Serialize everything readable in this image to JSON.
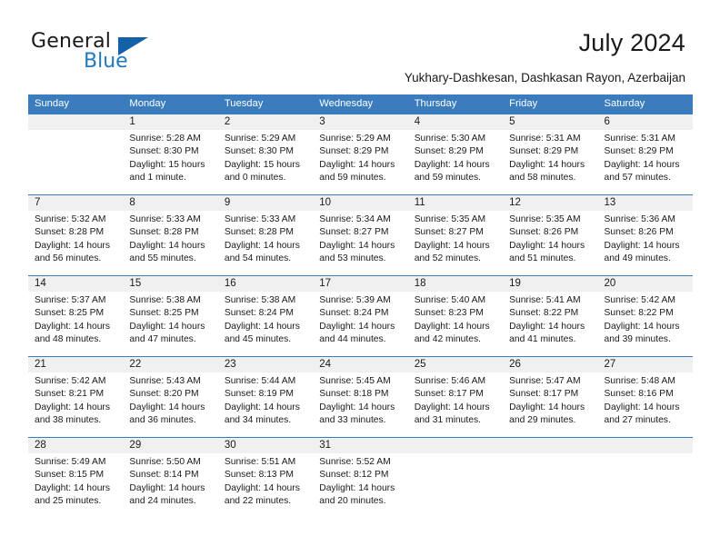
{
  "brand": {
    "word1": "General",
    "word2": "Blue",
    "triangle_icon": "triangle-icon",
    "blue": "#1f7ac0",
    "dark_blue": "#1361a6"
  },
  "header": {
    "month_year": "July 2024",
    "location": "Yukhary-Dashkesan, Dashkasan Rayon, Azerbaijan"
  },
  "calendar": {
    "header_bg": "#3a7cbe",
    "day_band_bg": "#f0f0f0",
    "weekdays": [
      "Sunday",
      "Monday",
      "Tuesday",
      "Wednesday",
      "Thursday",
      "Friday",
      "Saturday"
    ],
    "weeks": [
      [
        {
          "day": "",
          "l1": "",
          "l2": "",
          "l3": "",
          "l4": ""
        },
        {
          "day": "1",
          "l1": "Sunrise: 5:28 AM",
          "l2": "Sunset: 8:30 PM",
          "l3": "Daylight: 15 hours",
          "l4": "and 1 minute."
        },
        {
          "day": "2",
          "l1": "Sunrise: 5:29 AM",
          "l2": "Sunset: 8:30 PM",
          "l3": "Daylight: 15 hours",
          "l4": "and 0 minutes."
        },
        {
          "day": "3",
          "l1": "Sunrise: 5:29 AM",
          "l2": "Sunset: 8:29 PM",
          "l3": "Daylight: 14 hours",
          "l4": "and 59 minutes."
        },
        {
          "day": "4",
          "l1": "Sunrise: 5:30 AM",
          "l2": "Sunset: 8:29 PM",
          "l3": "Daylight: 14 hours",
          "l4": "and 59 minutes."
        },
        {
          "day": "5",
          "l1": "Sunrise: 5:31 AM",
          "l2": "Sunset: 8:29 PM",
          "l3": "Daylight: 14 hours",
          "l4": "and 58 minutes."
        },
        {
          "day": "6",
          "l1": "Sunrise: 5:31 AM",
          "l2": "Sunset: 8:29 PM",
          "l3": "Daylight: 14 hours",
          "l4": "and 57 minutes."
        }
      ],
      [
        {
          "day": "7",
          "l1": "Sunrise: 5:32 AM",
          "l2": "Sunset: 8:28 PM",
          "l3": "Daylight: 14 hours",
          "l4": "and 56 minutes."
        },
        {
          "day": "8",
          "l1": "Sunrise: 5:33 AM",
          "l2": "Sunset: 8:28 PM",
          "l3": "Daylight: 14 hours",
          "l4": "and 55 minutes."
        },
        {
          "day": "9",
          "l1": "Sunrise: 5:33 AM",
          "l2": "Sunset: 8:28 PM",
          "l3": "Daylight: 14 hours",
          "l4": "and 54 minutes."
        },
        {
          "day": "10",
          "l1": "Sunrise: 5:34 AM",
          "l2": "Sunset: 8:27 PM",
          "l3": "Daylight: 14 hours",
          "l4": "and 53 minutes."
        },
        {
          "day": "11",
          "l1": "Sunrise: 5:35 AM",
          "l2": "Sunset: 8:27 PM",
          "l3": "Daylight: 14 hours",
          "l4": "and 52 minutes."
        },
        {
          "day": "12",
          "l1": "Sunrise: 5:35 AM",
          "l2": "Sunset: 8:26 PM",
          "l3": "Daylight: 14 hours",
          "l4": "and 51 minutes."
        },
        {
          "day": "13",
          "l1": "Sunrise: 5:36 AM",
          "l2": "Sunset: 8:26 PM",
          "l3": "Daylight: 14 hours",
          "l4": "and 49 minutes."
        }
      ],
      [
        {
          "day": "14",
          "l1": "Sunrise: 5:37 AM",
          "l2": "Sunset: 8:25 PM",
          "l3": "Daylight: 14 hours",
          "l4": "and 48 minutes."
        },
        {
          "day": "15",
          "l1": "Sunrise: 5:38 AM",
          "l2": "Sunset: 8:25 PM",
          "l3": "Daylight: 14 hours",
          "l4": "and 47 minutes."
        },
        {
          "day": "16",
          "l1": "Sunrise: 5:38 AM",
          "l2": "Sunset: 8:24 PM",
          "l3": "Daylight: 14 hours",
          "l4": "and 45 minutes."
        },
        {
          "day": "17",
          "l1": "Sunrise: 5:39 AM",
          "l2": "Sunset: 8:24 PM",
          "l3": "Daylight: 14 hours",
          "l4": "and 44 minutes."
        },
        {
          "day": "18",
          "l1": "Sunrise: 5:40 AM",
          "l2": "Sunset: 8:23 PM",
          "l3": "Daylight: 14 hours",
          "l4": "and 42 minutes."
        },
        {
          "day": "19",
          "l1": "Sunrise: 5:41 AM",
          "l2": "Sunset: 8:22 PM",
          "l3": "Daylight: 14 hours",
          "l4": "and 41 minutes."
        },
        {
          "day": "20",
          "l1": "Sunrise: 5:42 AM",
          "l2": "Sunset: 8:22 PM",
          "l3": "Daylight: 14 hours",
          "l4": "and 39 minutes."
        }
      ],
      [
        {
          "day": "21",
          "l1": "Sunrise: 5:42 AM",
          "l2": "Sunset: 8:21 PM",
          "l3": "Daylight: 14 hours",
          "l4": "and 38 minutes."
        },
        {
          "day": "22",
          "l1": "Sunrise: 5:43 AM",
          "l2": "Sunset: 8:20 PM",
          "l3": "Daylight: 14 hours",
          "l4": "and 36 minutes."
        },
        {
          "day": "23",
          "l1": "Sunrise: 5:44 AM",
          "l2": "Sunset: 8:19 PM",
          "l3": "Daylight: 14 hours",
          "l4": "and 34 minutes."
        },
        {
          "day": "24",
          "l1": "Sunrise: 5:45 AM",
          "l2": "Sunset: 8:18 PM",
          "l3": "Daylight: 14 hours",
          "l4": "and 33 minutes."
        },
        {
          "day": "25",
          "l1": "Sunrise: 5:46 AM",
          "l2": "Sunset: 8:17 PM",
          "l3": "Daylight: 14 hours",
          "l4": "and 31 minutes."
        },
        {
          "day": "26",
          "l1": "Sunrise: 5:47 AM",
          "l2": "Sunset: 8:17 PM",
          "l3": "Daylight: 14 hours",
          "l4": "and 29 minutes."
        },
        {
          "day": "27",
          "l1": "Sunrise: 5:48 AM",
          "l2": "Sunset: 8:16 PM",
          "l3": "Daylight: 14 hours",
          "l4": "and 27 minutes."
        }
      ],
      [
        {
          "day": "28",
          "l1": "Sunrise: 5:49 AM",
          "l2": "Sunset: 8:15 PM",
          "l3": "Daylight: 14 hours",
          "l4": "and 25 minutes."
        },
        {
          "day": "29",
          "l1": "Sunrise: 5:50 AM",
          "l2": "Sunset: 8:14 PM",
          "l3": "Daylight: 14 hours",
          "l4": "and 24 minutes."
        },
        {
          "day": "30",
          "l1": "Sunrise: 5:51 AM",
          "l2": "Sunset: 8:13 PM",
          "l3": "Daylight: 14 hours",
          "l4": "and 22 minutes."
        },
        {
          "day": "31",
          "l1": "Sunrise: 5:52 AM",
          "l2": "Sunset: 8:12 PM",
          "l3": "Daylight: 14 hours",
          "l4": "and 20 minutes."
        },
        {
          "day": "",
          "l1": "",
          "l2": "",
          "l3": "",
          "l4": ""
        },
        {
          "day": "",
          "l1": "",
          "l2": "",
          "l3": "",
          "l4": ""
        },
        {
          "day": "",
          "l1": "",
          "l2": "",
          "l3": "",
          "l4": ""
        }
      ]
    ]
  }
}
